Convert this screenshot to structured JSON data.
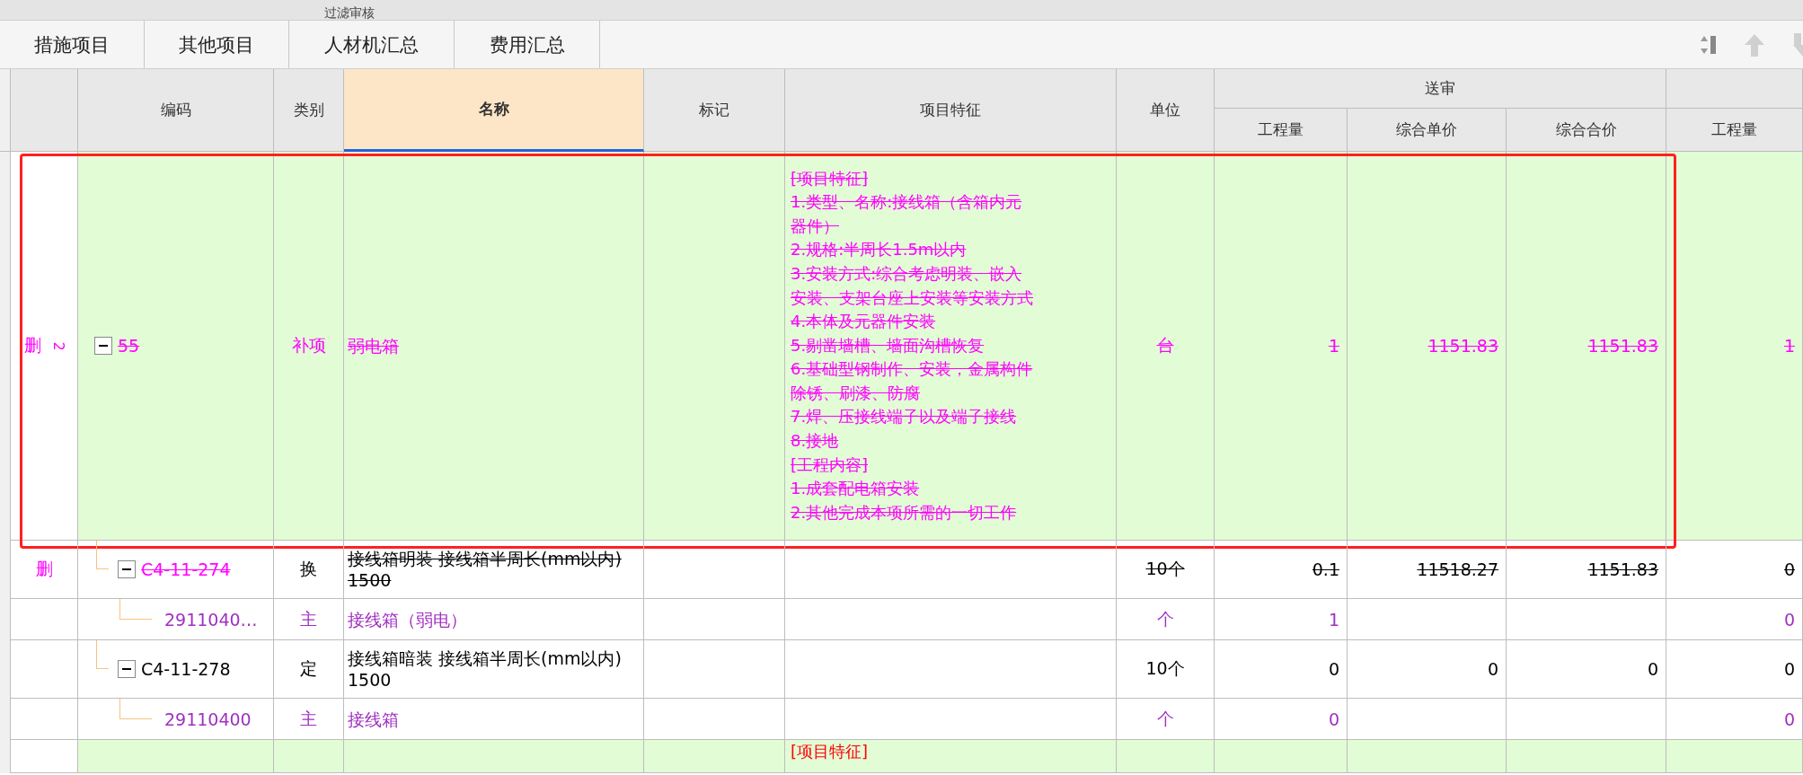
{
  "title": "过滤审核",
  "tabs": [
    {
      "label": "措施项目",
      "selected": false
    },
    {
      "label": "其他项目",
      "selected": false
    },
    {
      "label": "人材机汇总",
      "selected": false
    },
    {
      "label": "费用汇总",
      "selected": false
    }
  ],
  "header": {
    "group": "送审",
    "columns": [
      {
        "label": "编码",
        "selected": false
      },
      {
        "label": "类别",
        "selected": false
      },
      {
        "label": "名称",
        "selected": true
      },
      {
        "label": "标记",
        "selected": false
      },
      {
        "label": "项目特征",
        "selected": false
      },
      {
        "label": "单位",
        "selected": false
      },
      {
        "label": "工程量",
        "selected": false
      },
      {
        "label": "综合单价",
        "selected": false
      },
      {
        "label": "综合合价",
        "selected": false
      },
      {
        "label": "工程量",
        "selected": false
      }
    ]
  },
  "rows": [
    {
      "kind": "bill",
      "deleted": true,
      "selected": true,
      "mark": "删",
      "index": "2",
      "expanded": true,
      "code": "55",
      "type": "补项",
      "name": "弱电箱",
      "features": [
        "[项目特征]",
        "1.类型、名称:接线箱（含箱内元",
        "器件）",
        "2.规格:半周长1.5m以内",
        "3.安装方式:综合考虑明装、嵌入",
        "安装、支架台座上安装等安装方式",
        "4.本体及元器件安装",
        "5.剔凿墙槽、墙面沟槽恢复",
        "6.基础型钢制作、安装，金属构件",
        "除锈、刷漆、防腐",
        "7.焊、压接线端子以及端子接线",
        "8.接地",
        "[工程内容]",
        "1.成套配电箱安装",
        "2.其他完成本项所需的一切工作"
      ],
      "unit": "台",
      "quantity": "1",
      "unit_price": "1151.83",
      "total": "1151.83",
      "quantity_2": "1",
      "children": [
        {
          "kind": "quota",
          "deleted": true,
          "selected": false,
          "mark": "删",
          "expanded": true,
          "code": "C4-11-274",
          "type": "换",
          "name": "接线箱明装 接线箱半周长(mm以内) 1500",
          "unit": "10个",
          "quantity": "0.1",
          "unit_price": "11518.27",
          "total": "1151.83",
          "quantity_2": "0",
          "children": [
            {
              "kind": "material",
              "deleted": false,
              "selected": false,
              "code": "2911040…",
              "type": "主",
              "name": "接线箱（弱电）",
              "unit": "个",
              "quantity": "1",
              "quantity_2": "0"
            }
          ]
        },
        {
          "kind": "quota",
          "deleted": false,
          "selected": false,
          "expanded": true,
          "code": "C4-11-278",
          "type": "定",
          "name": "接线箱暗装 接线箱半周长(mm以内) 1500",
          "unit": "10个",
          "quantity": "0",
          "unit_price": "0",
          "total": "0",
          "quantity_2": "0",
          "children": [
            {
              "kind": "material",
              "deleted": false,
              "selected": false,
              "code": "29110400",
              "type": "主",
              "name": "接线箱",
              "unit": "个",
              "quantity": "0",
              "quantity_2": "0"
            }
          ]
        }
      ]
    },
    {
      "kind": "bill",
      "deleted": false,
      "selected": false,
      "features": [
        "[项目特征]"
      ]
    }
  ]
}
